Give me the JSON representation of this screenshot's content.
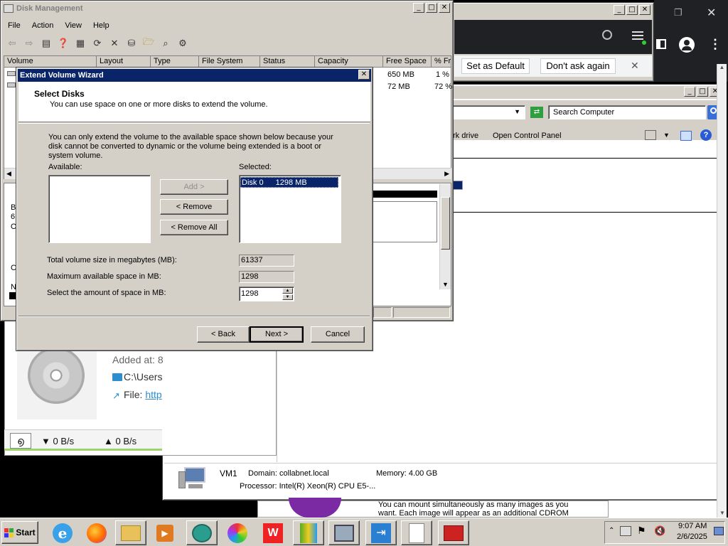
{
  "disk_mgmt": {
    "title": "Disk Management",
    "menu": [
      "File",
      "Action",
      "View",
      "Help"
    ],
    "columns": [
      "Volume",
      "Layout",
      "Type",
      "File System",
      "Status",
      "Capacity",
      "Free Space",
      "% Fr"
    ],
    "rows": [
      {
        "free": "650 MB",
        "pct": "1 %"
      },
      {
        "free": "72 MB",
        "pct": "72 %"
      }
    ],
    "left_pane_letters": [
      "B",
      "6",
      "O",
      "C",
      "N"
    ]
  },
  "wizard": {
    "title": "Extend Volume Wizard",
    "header_title": "Select Disks",
    "header_subtitle": "You can use space on one or more disks to extend the volume.",
    "description": "You can only extend the volume to the available space shown below because your disk cannot be converted to dynamic or the volume being extended is a boot or system volume.",
    "available_label": "Available:",
    "selected_label": "Selected:",
    "selected_items": [
      {
        "disk": "Disk 0",
        "size": "1298 MB"
      }
    ],
    "add_label": "Add >",
    "remove_label": "< Remove",
    "remove_all_label": "< Remove All",
    "total_label": "Total volume size in megabytes (MB):",
    "total_value": "61337",
    "max_label": "Maximum available space in MB:",
    "max_value": "1298",
    "amount_label": "Select the amount of space in MB:",
    "amount_value": "1298",
    "back_label": "< Back",
    "next_label": "Next >",
    "cancel_label": "Cancel"
  },
  "browser_bar": {
    "set_default": "Set as Default",
    "dont_ask": "Don't ask again"
  },
  "explorer": {
    "search_placeholder": "Search Computer",
    "toolbar_items": [
      "rk drive",
      "Open Control Panel"
    ],
    "computer_name": "VM1",
    "domain_label": "Domain: collabnet.local",
    "memory_label": "Memory: 4.00 GB",
    "processor_label": "Processor: Intel(R) Xeon(R) CPU E5-..."
  },
  "download_panel": {
    "added_at": "Added at: 8",
    "path": "C:\\Users",
    "file_label": "File: ",
    "file_link": "http",
    "down_speed": "▼ 0 B/s",
    "up_speed": "▲ 0 B/s"
  },
  "background_text": {
    "mount_text_1": "You can mount simultaneously as many images as you",
    "mount_text_2": "want. Each image will appear as an additional CDROM"
  },
  "taskbar": {
    "start_label": "Start",
    "time": "9:07 AM",
    "date": "2/6/2025"
  },
  "colors": {
    "title_active": "#0a246a",
    "selection": "#0a246a",
    "window_face": "#d4d0c8",
    "dark_chrome": "#202124"
  }
}
